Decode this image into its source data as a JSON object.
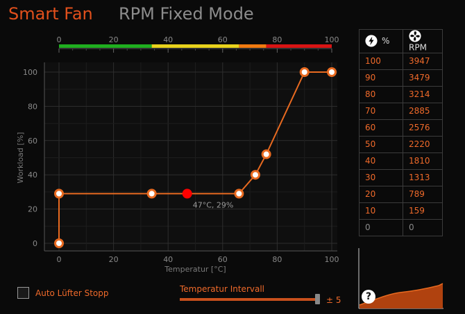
{
  "tabs": {
    "smart_fan": "Smart Fan",
    "rpm_fixed": "RPM Fixed Mode"
  },
  "colors": {
    "accent": "#e2501c",
    "curve": "#e86a20",
    "current_point": "#ff0000",
    "table_text": "#f06a2a"
  },
  "temp_bar": {
    "ticks": [
      "0",
      "20",
      "40",
      "60",
      "80",
      "100"
    ],
    "segments": [
      {
        "from": 0,
        "to": 34,
        "color": "#1fae1f"
      },
      {
        "from": 34,
        "to": 66,
        "color": "#e8d21c"
      },
      {
        "from": 66,
        "to": 76,
        "color": "#f07a10"
      },
      {
        "from": 76,
        "to": 100,
        "color": "#d81414"
      }
    ]
  },
  "chart_data": {
    "type": "line",
    "xlabel": "Temperatur [°C]",
    "ylabel": "Workload [%]",
    "xlim": [
      0,
      100
    ],
    "ylim": [
      0,
      100
    ],
    "x_ticks": [
      "0",
      "20",
      "40",
      "60",
      "80",
      "100"
    ],
    "y_ticks": [
      "0",
      "20",
      "40",
      "60",
      "80",
      "100"
    ],
    "grid": true,
    "points": [
      {
        "x": 0,
        "y": 0
      },
      {
        "x": 0,
        "y": 29
      },
      {
        "x": 34,
        "y": 29
      },
      {
        "x": 66,
        "y": 29
      },
      {
        "x": 72,
        "y": 40
      },
      {
        "x": 76,
        "y": 52
      },
      {
        "x": 90,
        "y": 100
      },
      {
        "x": 100,
        "y": 100
      }
    ],
    "current": {
      "x": 47,
      "y": 29,
      "label": "47°C, 29%"
    }
  },
  "rpm_table": {
    "header_percent": "%",
    "header_rpm": "RPM",
    "rows": [
      {
        "percent": "100",
        "rpm": "3947"
      },
      {
        "percent": "90",
        "rpm": "3479"
      },
      {
        "percent": "80",
        "rpm": "3214"
      },
      {
        "percent": "70",
        "rpm": "2885"
      },
      {
        "percent": "60",
        "rpm": "2576"
      },
      {
        "percent": "50",
        "rpm": "2220"
      },
      {
        "percent": "40",
        "rpm": "1810"
      },
      {
        "percent": "30",
        "rpm": "1313"
      },
      {
        "percent": "20",
        "rpm": "789"
      },
      {
        "percent": "10",
        "rpm": "159"
      },
      {
        "percent": "0",
        "rpm": "0"
      }
    ]
  },
  "mini_graph": {
    "help_symbol": "?"
  },
  "auto_stop": {
    "label": "Auto Lüfter Stopp",
    "checked": false
  },
  "interval": {
    "title": "Temperatur Intervall",
    "value_label": "± 5",
    "value": 5
  }
}
